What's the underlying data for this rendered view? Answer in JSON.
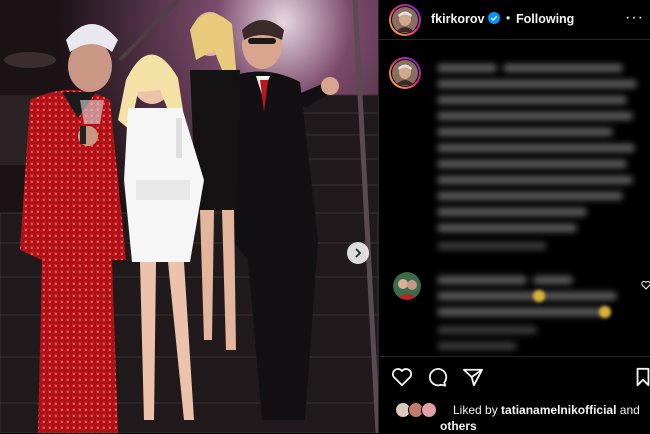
{
  "post": {
    "username": "fkirkorov",
    "separator": "•",
    "follow_status": "Following",
    "more_label": "···"
  },
  "photo": {
    "description": ""
  },
  "likes": {
    "prefix": "Liked by",
    "user": "tatianamelnikofficial",
    "and": "and",
    "others": "others"
  },
  "colors": {
    "background": "#000000",
    "divider": "#262626",
    "verified": "#0095f6",
    "text": "#f5f5f5"
  },
  "icons": [
    "verified-badge-icon",
    "more-options-icon",
    "chevron-right-icon",
    "heart-icon",
    "comment-icon",
    "share-icon",
    "bookmark-icon"
  ]
}
